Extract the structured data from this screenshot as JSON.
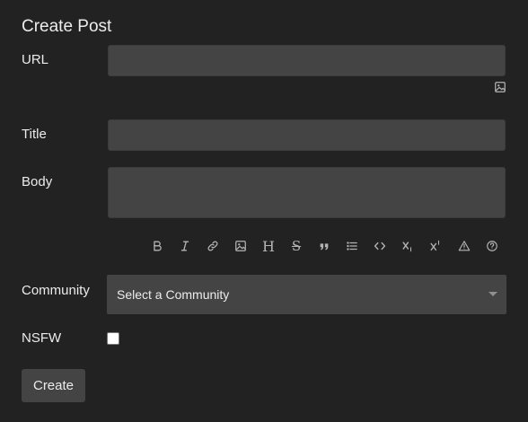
{
  "form": {
    "title": "Create Post",
    "url_label": "URL",
    "url_value": "",
    "title_label": "Title",
    "title_value": "",
    "body_label": "Body",
    "body_value": "",
    "community_label": "Community",
    "community_selected": "Select a Community",
    "nsfw_label": "NSFW",
    "nsfw_checked": false,
    "create_label": "Create"
  },
  "toolbar": {
    "items": [
      {
        "name": "bold-icon"
      },
      {
        "name": "italic-icon"
      },
      {
        "name": "link-icon"
      },
      {
        "name": "image-icon"
      },
      {
        "name": "header-icon",
        "glyph": "H"
      },
      {
        "name": "strikethrough-icon",
        "glyph": "S"
      },
      {
        "name": "quote-icon"
      },
      {
        "name": "list-icon"
      },
      {
        "name": "code-icon"
      },
      {
        "name": "subscript-icon"
      },
      {
        "name": "superscript-icon"
      },
      {
        "name": "spoiler-warning-icon"
      },
      {
        "name": "help-icon"
      }
    ]
  },
  "colors": {
    "background": "#222222",
    "input_background": "#444444",
    "text": "#ececec",
    "icon": "#b4b4b4"
  }
}
